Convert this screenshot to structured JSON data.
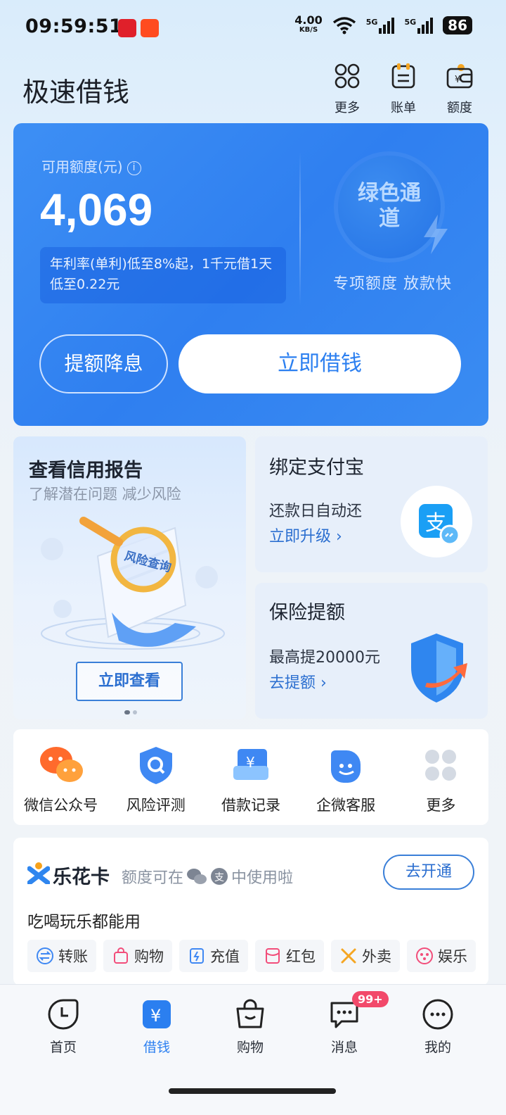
{
  "status_bar": {
    "time": "09:59:51",
    "net_speed": "4.00",
    "net_unit": "KB/S",
    "net_signal_1": "5G",
    "net_signal_2": "5G",
    "battery": "86"
  },
  "header": {
    "title": "极速借钱",
    "buttons": [
      {
        "label": "更多",
        "icon": "grid-dots-icon"
      },
      {
        "label": "账单",
        "icon": "bill-icon"
      },
      {
        "label": "额度",
        "icon": "wallet-icon"
      }
    ]
  },
  "main_card": {
    "quota_label": "可用额度(元)",
    "quota_value": "4,069",
    "rate_text": "年利率(单利)低至8%起，1千元借1天低至0.22元",
    "green_channel": "绿色通道",
    "special_text": "专项额度  放款快",
    "raise_button": "提额降息",
    "borrow_button": "立即借钱"
  },
  "credit_report": {
    "title": "查看信用报告",
    "subtitle": "了解潜在问题 减少风险",
    "button": "立即查看",
    "illustration_stamp": "风险查询"
  },
  "alipay_card": {
    "title": "绑定支付宝",
    "desc": "还款日自动还",
    "link": "立即升级 ›"
  },
  "insurance_card": {
    "title": "保险提额",
    "desc": "最高提20000元",
    "link": "去提额 ›"
  },
  "quick_menu": [
    {
      "label": "微信公众号",
      "icon": "wechat-icon"
    },
    {
      "label": "风险评测",
      "icon": "risk-shield-icon"
    },
    {
      "label": "借款记录",
      "icon": "loan-record-icon"
    },
    {
      "label": "企微客服",
      "icon": "customer-service-icon"
    },
    {
      "label": "更多",
      "icon": "more-grid-icon"
    }
  ],
  "lehua": {
    "title": "乐花卡",
    "note_prefix": "额度可在",
    "note_suffix": "中使用啦",
    "open_button": "去开通",
    "subtitle": "吃喝玩乐都能用",
    "tags": [
      {
        "label": "转账",
        "icon": "transfer-icon"
      },
      {
        "label": "购物",
        "icon": "shopping-bag-icon"
      },
      {
        "label": "充值",
        "icon": "recharge-icon"
      },
      {
        "label": "红包",
        "icon": "red-packet-icon"
      },
      {
        "label": "外卖",
        "icon": "takeout-icon"
      },
      {
        "label": "娱乐",
        "icon": "game-icon"
      }
    ]
  },
  "bottom_nav": [
    {
      "label": "首页"
    },
    {
      "label": "借钱"
    },
    {
      "label": "购物"
    },
    {
      "label": "消息"
    },
    {
      "label": "我的"
    }
  ],
  "message_badge": "99+",
  "colors": {
    "accent": "#2b7ff0",
    "card_blue": "#3d8ff4",
    "badge_red": "#f2496a"
  }
}
